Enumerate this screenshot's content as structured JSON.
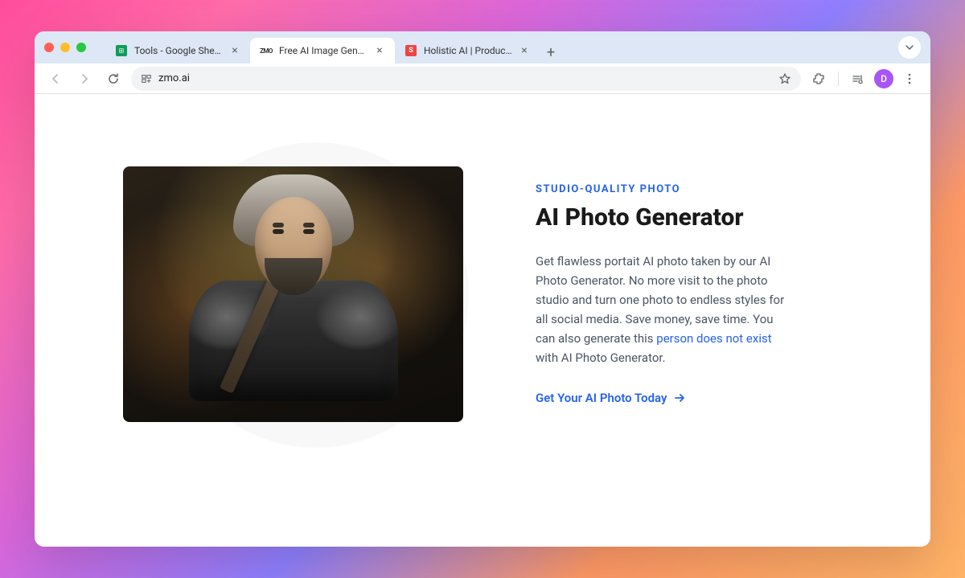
{
  "browser": {
    "tabs": [
      {
        "title": "Tools - Google Sheets",
        "active": false
      },
      {
        "title": "Free AI Image Generator To C",
        "active": true
      },
      {
        "title": "Holistic AI | Production",
        "active": false
      }
    ],
    "url": "zmo.ai",
    "profile_initial": "D"
  },
  "page": {
    "eyebrow": "STUDIO-QUALITY PHOTO",
    "title": "AI Photo Generator",
    "description_part1": "Get flawless portait AI photo taken by our AI Photo Generator. No more visit to the photo studio and turn one photo to endless styles for all social media. Save money, save time. You can also generate this ",
    "description_link": "person does not exist",
    "description_part2": " with AI Photo Generator.",
    "cta_label": "Get Your AI Photo Today"
  }
}
